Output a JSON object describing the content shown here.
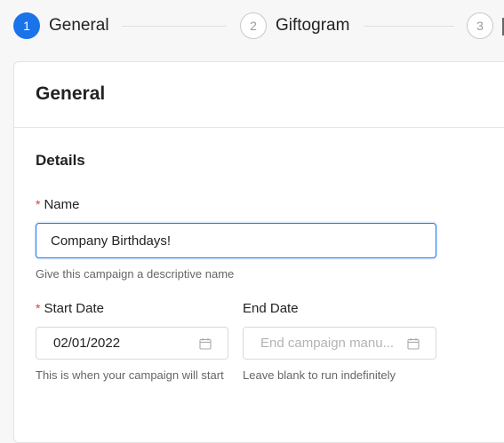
{
  "stepper": {
    "steps": [
      {
        "number": "1",
        "label": "General",
        "state": "active"
      },
      {
        "number": "2",
        "label": "Giftogram",
        "state": "inactive"
      },
      {
        "number": "3",
        "label": "",
        "state": "inactive"
      }
    ]
  },
  "card": {
    "title": "General",
    "section_title": "Details",
    "name_field": {
      "required_mark": "*",
      "label": "Name",
      "value": "Company Birthdays!",
      "help": "Give this campaign a descriptive name"
    },
    "start_date": {
      "required_mark": "*",
      "label": "Start Date",
      "value": "02/01/2022",
      "icon": "calendar-icon",
      "help": "This is when your campaign will start"
    },
    "end_date": {
      "label": "End Date",
      "placeholder": "End campaign manu...",
      "icon": "calendar-icon",
      "help": "Leave blank to run indefinitely"
    }
  },
  "colors": {
    "accent": "#1a73e8",
    "required": "#e03a3a"
  }
}
